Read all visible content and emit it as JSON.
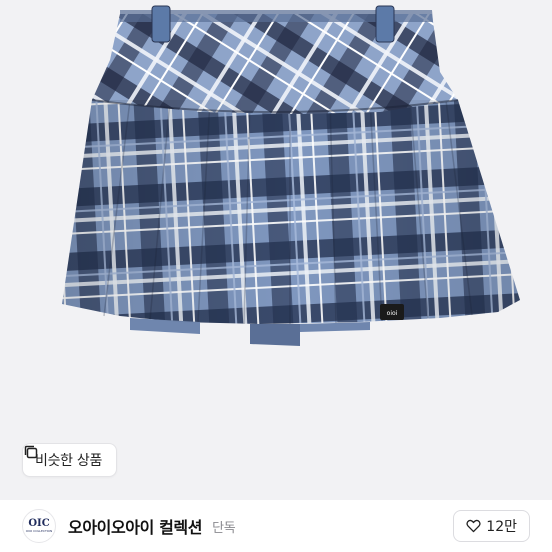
{
  "product": {
    "image_alt_colors": {
      "background": "#f2f2f4",
      "plaid_base": "#7f97bf",
      "plaid_dark": "#1f2740",
      "plaid_light": "#e9eef6",
      "label_tag": "#1a1a1a"
    },
    "label_tag_text": "oioi"
  },
  "similar_button": {
    "label": "비슷한 상품",
    "icon": "copy-icon"
  },
  "brand": {
    "logo_mark": "OIC",
    "logo_sub": "OIOI COLLECTION",
    "name": "오아이오아이 컬렉션",
    "tag": "단독"
  },
  "like": {
    "icon": "heart-icon",
    "count": "12만"
  }
}
